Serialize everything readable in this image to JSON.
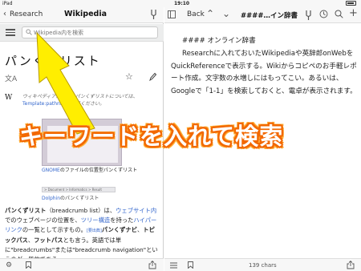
{
  "status": {
    "carrier": "iPad",
    "time": "19:10"
  },
  "left": {
    "nav": {
      "back_label": "Research",
      "title": "Wikipedia"
    },
    "search": {
      "placeholder": "Wikipedia内を検索"
    },
    "article": {
      "title": "パンくずリスト",
      "note_text": "ウィキペディアにおけるパンくずリストについては、",
      "note_link": "Template:pathnav",
      "note_tail": "をご覧ください。",
      "caption1_link": "GNOME",
      "caption1_rest": "のファイルの位置型パンくずリスト",
      "crumb_sample": "> Document > Informatics > Result",
      "caption2_link": "Dolphin",
      "caption2_rest": "のパンくずリスト",
      "body": {
        "b1": "パンくずリスト",
        "t1": "（breadcrumb list）は、",
        "l1": "ウェブサイト内",
        "t2": "でのウェブページの位置を、",
        "l2": "ツリー構造",
        "t3": "を持った",
        "l3": "ハイパーリンク",
        "t4": "の一覧として示すもの。",
        "sup": "[要出典]",
        "b2": "パンくずナビ",
        "t5": "、",
        "b3": "トピックパス",
        "t6": "、",
        "b4": "フットパス",
        "t7": "とも言う。英語では単に\"breadcrumbs\"または\"breadcrumb navigation\"というのが一般的である。"
      }
    }
  },
  "right": {
    "nav": {
      "back_label": "Back",
      "title": "####…イン辞書"
    },
    "doc": {
      "heading": "#### オンライン辞書",
      "paragraph": "Researchに入れておいたWikipediaや英辞郎onWebをQuickReferenceで表示する。Wikiからコピペのお手軽レポート作成。文字数の水増しにはもってこい。あるいは、Googleで「1-1」を検索しておくと、電卓が表示されます。"
    },
    "char_count": "139 chars"
  },
  "overlay": {
    "banner": "キーワードを入れて検索"
  },
  "colors": {
    "link": "#3366cc",
    "arrow": "#ffee00",
    "banner_outline": "#f26800"
  }
}
